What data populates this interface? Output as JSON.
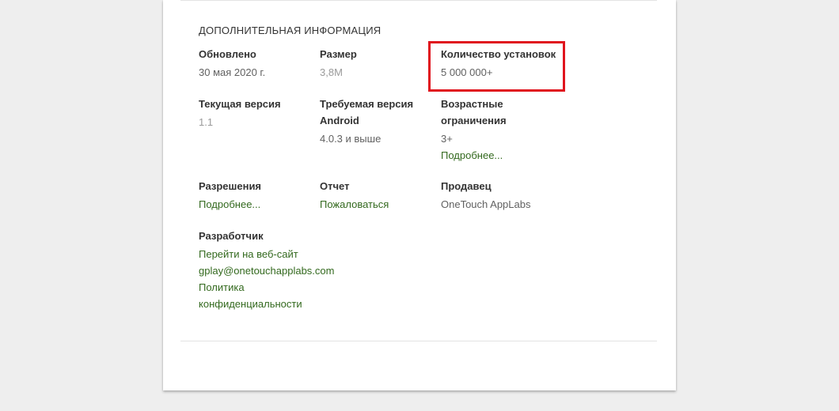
{
  "section_title": "ДОПОЛНИТЕЛЬНАЯ ИНФОРМАЦИЯ",
  "updated": {
    "label": "Обновлено",
    "value": "30 мая 2020 г."
  },
  "size": {
    "label": "Размер",
    "value": "3,8M"
  },
  "installs": {
    "label": "Количество установок",
    "value": "5 000 000+"
  },
  "current_version": {
    "label": "Текущая версия",
    "value": "1.1"
  },
  "required_android": {
    "label_line1": "Требуемая версия",
    "label_line2": "Android",
    "value": "4.0.3 и выше"
  },
  "age_rating": {
    "label_line1": "Возрастные",
    "label_line2": "ограничения",
    "value": "3+",
    "link": "Подробнее..."
  },
  "permissions": {
    "label": "Разрешения",
    "link": "Подробнее..."
  },
  "report": {
    "label": "Отчет",
    "link": "Пожаловаться"
  },
  "seller": {
    "label": "Продавец",
    "value": "OneTouch AppLabs"
  },
  "developer": {
    "label": "Разработчик",
    "website_link": "Перейти на веб-сайт",
    "email_link": "gplay@onetouchapplabs.com",
    "privacy_line1": "Политика",
    "privacy_line2": "конфиденциальности"
  },
  "colors": {
    "link": "#33691e",
    "highlight_border": "#e0141e",
    "background": "#eeeeee",
    "card": "#ffffff"
  }
}
